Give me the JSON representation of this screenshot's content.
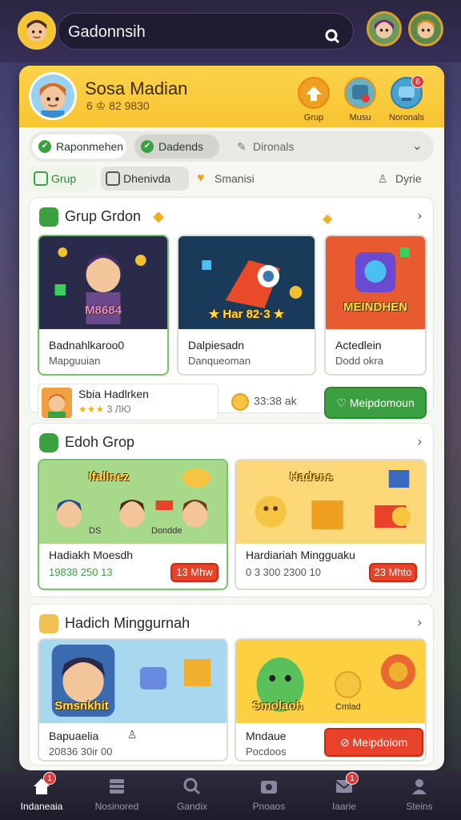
{
  "header": {
    "search_text": "Gadonnsih"
  },
  "profile": {
    "name": "Sosa Madian",
    "sub": "6 ♔ 82 9830",
    "buttons": [
      {
        "label": "Grup",
        "icon": "group-icon"
      },
      {
        "label": "Musu",
        "icon": "music-icon"
      },
      {
        "label": "Noronals",
        "icon": "notifications-icon",
        "badge": "8"
      }
    ]
  },
  "filters": [
    {
      "label": "Raponmehen"
    },
    {
      "label": "Dadends"
    },
    {
      "label": "Dironals"
    }
  ],
  "tabs": [
    {
      "label": "Grup"
    },
    {
      "label": "Dhenivda"
    },
    {
      "label": "Smanisi"
    },
    {
      "label": "Dyrie"
    }
  ],
  "section1": {
    "title": "Grup Grdon",
    "cards": [
      {
        "banner": "M8684",
        "title": "Badnahlkaroo0",
        "sub": "Mapguuian"
      },
      {
        "banner": "★ Har 82·3 ★",
        "title": "Dalpiesadn",
        "sub": "Danqueoman"
      },
      {
        "banner": "MEINDHEN",
        "title": "Actedlein",
        "sub": "Dodd okra"
      }
    ],
    "player": {
      "name": "Sbia Hadlrken",
      "stars": "★★★",
      "rating": "3 ЛЮ"
    },
    "coins": "33:38 ak",
    "action_label": "Meipdomoun"
  },
  "section2": {
    "title": "Edoh Grop",
    "cards": [
      {
        "banner": "Ifallnez",
        "tag": "DS",
        "tag2": "Dondde",
        "title": "Hadiakh Moesdh",
        "sub": "19838 250 13",
        "price": "13 Mhw"
      },
      {
        "banner": "Hadens",
        "title": "Hardiariah Mingguaku",
        "sub": "0 3 300 2300 10",
        "price": "23 Mhto"
      }
    ]
  },
  "section3": {
    "title": "Hadich Minggurnah",
    "cards": [
      {
        "banner": "Smsnkhit",
        "title": "Bapuaelia",
        "sub": "20836 30ir 00"
      },
      {
        "banner": "Smolaoh",
        "coin_label": "Cmlad",
        "title": "Mndaue",
        "sub": "Pocdoos"
      }
    ],
    "action_label": "Meipdoiom"
  },
  "bottom_nav": [
    {
      "label": "Indaneaia",
      "badge": "1",
      "active": true
    },
    {
      "label": "Nosinored"
    },
    {
      "label": "Gandix"
    },
    {
      "label": "Pnoaos"
    },
    {
      "label": "Iaarie",
      "badge": "1"
    },
    {
      "label": "Steins"
    }
  ],
  "colors": {
    "accent_yellow": "#f7c431",
    "green": "#3aa040",
    "red": "#e8432a",
    "dark_bg": "#2a2540"
  }
}
